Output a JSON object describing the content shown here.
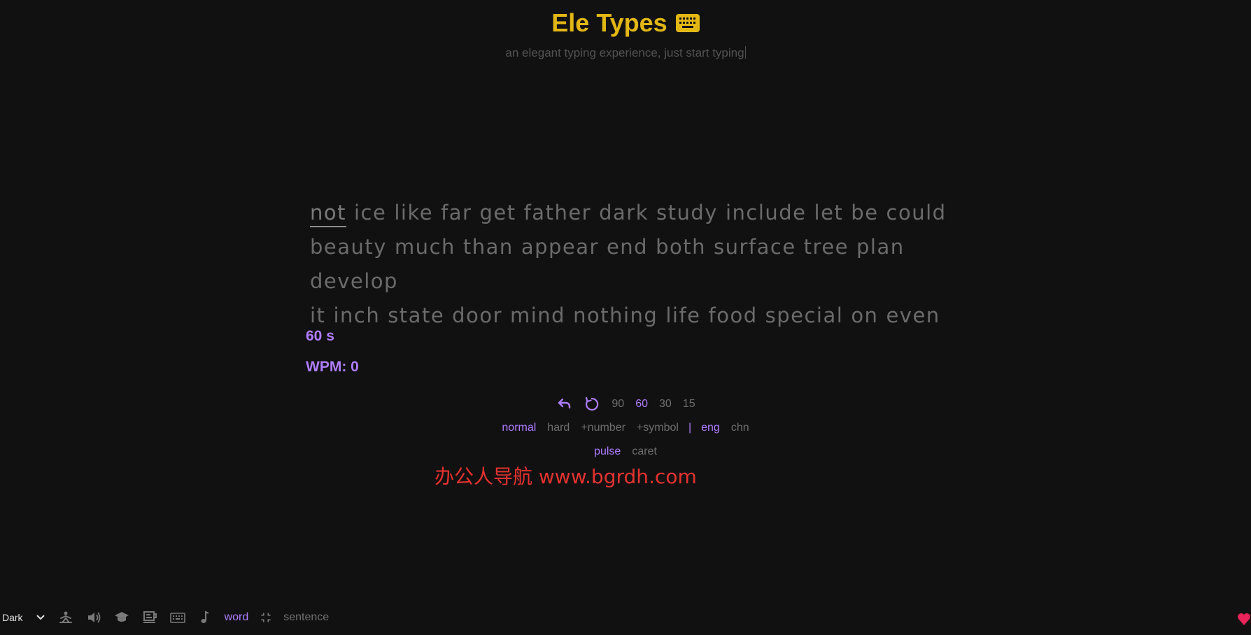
{
  "header": {
    "title": "Ele Types",
    "subtitle": "an elegant typing experience, just start typing"
  },
  "words": {
    "lines": [
      [
        "not",
        "ice",
        "like",
        "far",
        "get",
        "father",
        "dark",
        "study",
        "include",
        "let",
        "be",
        "could"
      ],
      [
        "beauty",
        "much",
        "than",
        "appear",
        "end",
        "both",
        "surface",
        "tree",
        "plan",
        "develop"
      ],
      [
        "it",
        "inch",
        "state",
        "door",
        "mind",
        "nothing",
        "life",
        "food",
        "special",
        "on",
        "even"
      ]
    ],
    "current_index": 0
  },
  "stats": {
    "timer": "60 s",
    "wpm": "WPM: 0"
  },
  "controls": {
    "durations": [
      "90",
      "60",
      "30",
      "15"
    ],
    "selected_duration": "60",
    "difficulty": [
      "normal",
      "hard",
      "+number",
      "+symbol"
    ],
    "selected_difficulty": "normal",
    "separator": "|",
    "language": [
      "eng",
      "chn"
    ],
    "selected_language": "eng",
    "caret_style": [
      "pulse",
      "caret"
    ],
    "selected_caret_style": "pulse"
  },
  "watermark": "办公人导航 www.bgrdh.com",
  "footer": {
    "theme": "Dark",
    "icons": [
      "zen-mode-icon",
      "sound-icon",
      "graduation-cap-icon",
      "coffee-icon",
      "keyboard-icon",
      "music-note-icon"
    ],
    "word_label": "word",
    "sentence_label": "sentence"
  },
  "colors": {
    "background": "#111111",
    "accent": "#b07dff",
    "title": "#e2b714",
    "text_muted": "#6b6b6b",
    "watermark": "#e5322f",
    "heart": "#e8245a"
  }
}
